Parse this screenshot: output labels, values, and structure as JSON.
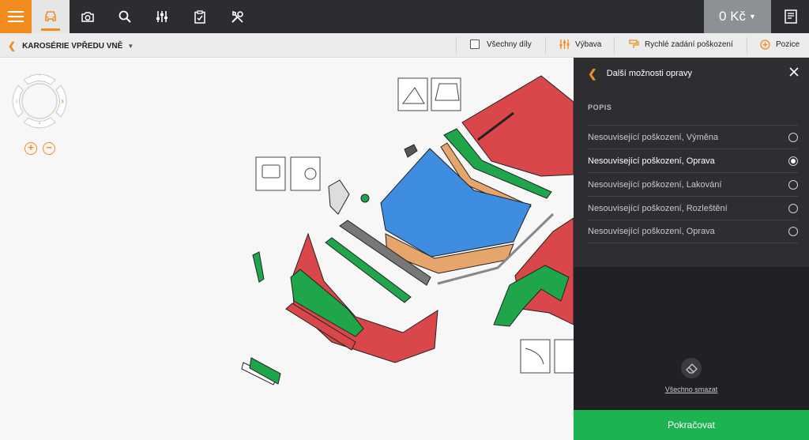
{
  "toolbar": {
    "icons": [
      "menu-icon",
      "car-icon",
      "camera-icon",
      "search-icon",
      "sliders-icon",
      "clipboard-icon",
      "tools-icon"
    ],
    "price": "0 Kč",
    "receipt_icon": "receipt-icon",
    "accent": "#f28c1e"
  },
  "subbar": {
    "title": "KAROSÉRIE VPŘEDU VNĚ",
    "all_parts_label": "Všechny díly",
    "equipment_label": "Výbava",
    "quick_damage_label": "Rychlé zadání poškození",
    "position_label": "Pozice"
  },
  "panel": {
    "title": "Další možnosti opravy",
    "section_label": "POPIS",
    "options": [
      {
        "label": "Nesouvisející poškození, Výměna",
        "selected": false
      },
      {
        "label": "Nesouvisející poškození, Oprava",
        "selected": true
      },
      {
        "label": "Nesouvisející poškození, Lakování",
        "selected": false
      },
      {
        "label": "Nesouvisející poškození, Rozleštění",
        "selected": false
      },
      {
        "label": "Nesouvisející poškození, Oprava",
        "selected": false
      }
    ],
    "erase_all_label": "Všechno smazat",
    "continue_label": "Pokračovat",
    "continue_color": "#1eb351"
  },
  "diagram": {
    "part_colors": {
      "replace": "#d9474b",
      "repair": "#1fa64a",
      "paint": "#3f8de0",
      "polish": "#e6a56a"
    }
  }
}
